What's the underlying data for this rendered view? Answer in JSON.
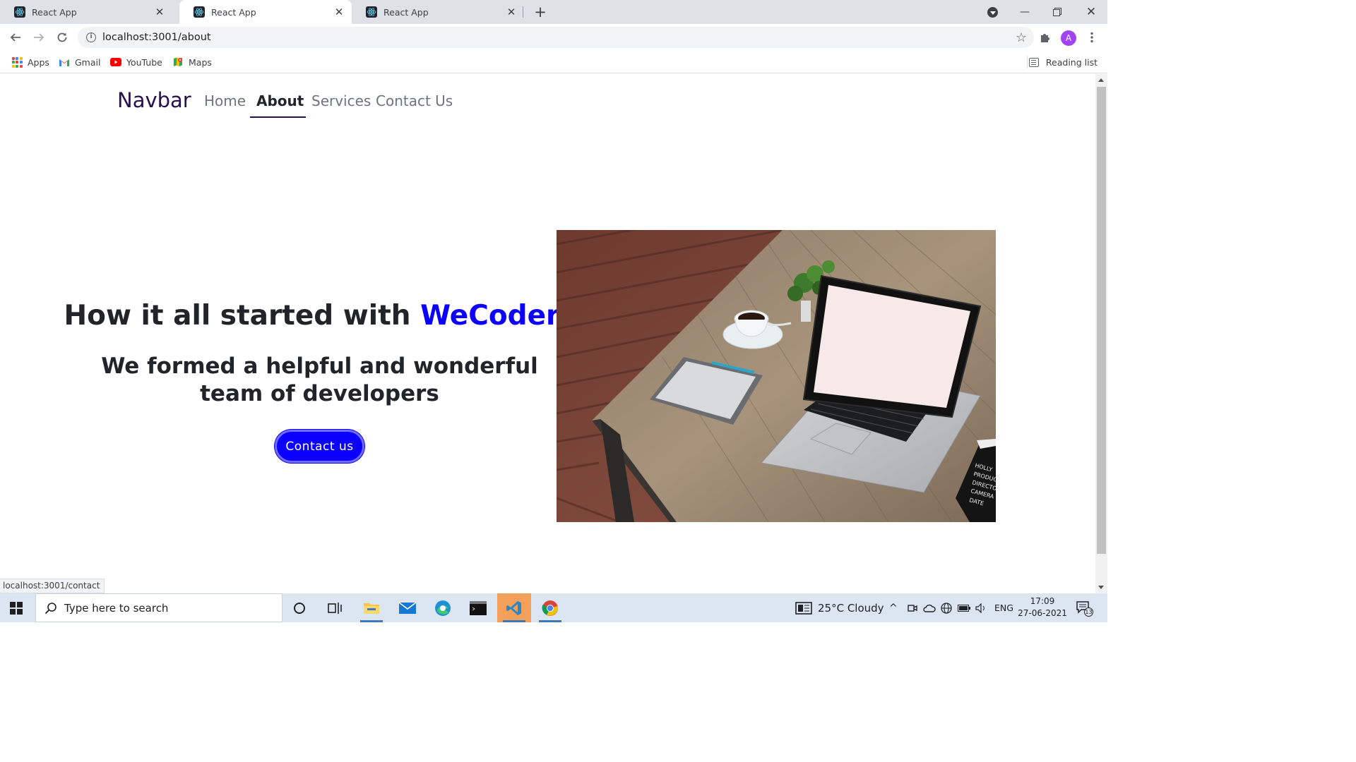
{
  "browser": {
    "tabs": [
      {
        "title": "React App",
        "active": false
      },
      {
        "title": "React App",
        "active": true
      },
      {
        "title": "React App",
        "active": false
      }
    ],
    "address": "localhost:3001/about",
    "profile_initial": "A",
    "bookmarks": [
      {
        "label": "Apps",
        "icon": "apps-grid-icon"
      },
      {
        "label": "Gmail",
        "icon": "gmail-icon"
      },
      {
        "label": "YouTube",
        "icon": "youtube-icon"
      },
      {
        "label": "Maps",
        "icon": "maps-icon"
      }
    ],
    "reading_list": "Reading list",
    "status_url": "localhost:3001/contact"
  },
  "page": {
    "navbar": {
      "brand": "Navbar",
      "links": [
        {
          "label": "Home",
          "active": false
        },
        {
          "label": "About",
          "active": true
        },
        {
          "label": "Services",
          "active": false
        },
        {
          "label": "Contact Us",
          "active": false
        }
      ]
    },
    "hero": {
      "title_prefix": "How it all started with ",
      "title_brand": "WeCoders",
      "subtitle": "We formed a helpful and wonderful team of developers",
      "cta_label": "Contact us",
      "clapper_lines": [
        "HOLLY",
        "PRODUC",
        "DIRECTO",
        "CAMERA",
        "DATE"
      ]
    }
  },
  "taskbar": {
    "search_placeholder": "Type here to search",
    "weather": "25°C  Cloudy",
    "language": "ENG",
    "time": "17:09",
    "date": "27-06-2021",
    "notification_count": "13"
  },
  "colors": {
    "brand_blue": "#0b00ff",
    "navbar_brand": "#2a0e4e",
    "tab_strip": "#dee1e6",
    "taskbar": "#dce6f2"
  }
}
